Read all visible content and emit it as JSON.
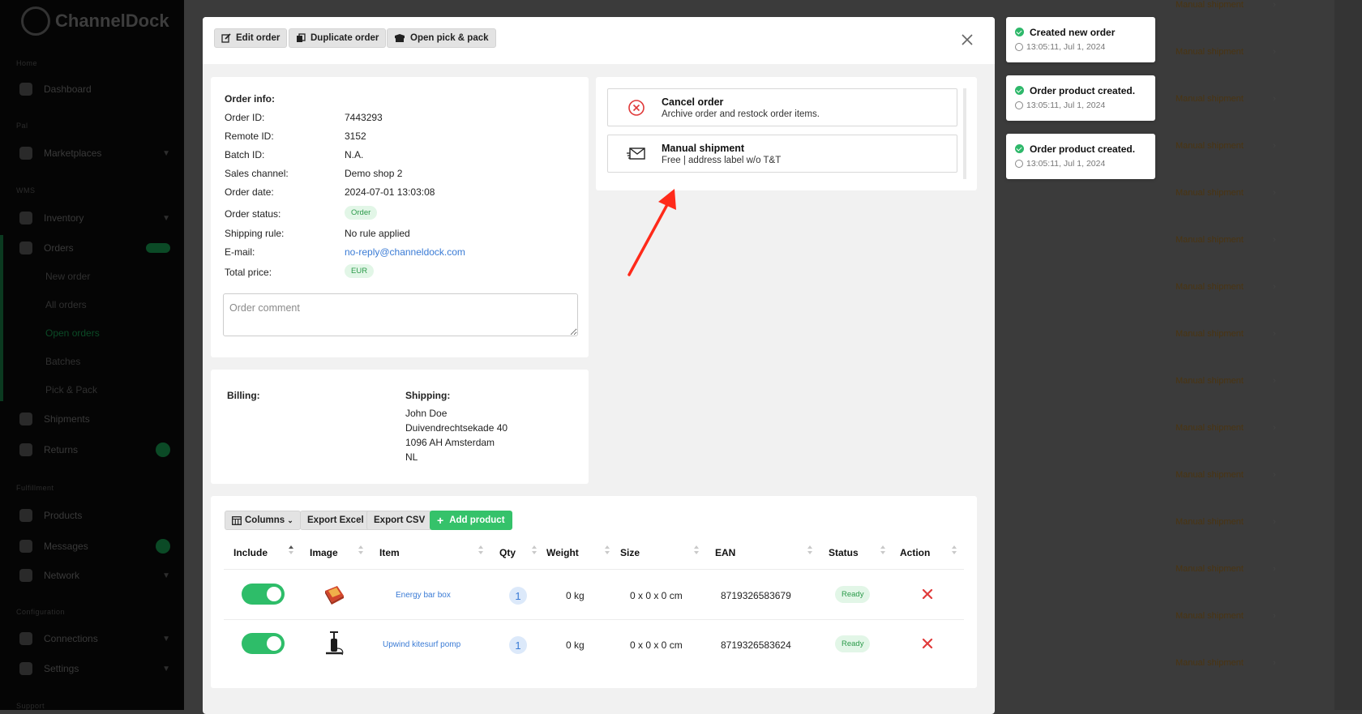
{
  "app": {
    "brand": "ChannelDock"
  },
  "sidebar": {
    "sections": [
      "Home",
      "Pal",
      "WMS",
      "Fulfillment",
      "Configuration",
      "Support"
    ],
    "items": [
      {
        "label": "Dashboard"
      },
      {
        "label": "Marketplaces"
      },
      {
        "label": "Inventory"
      },
      {
        "label": "Orders"
      },
      {
        "label": "Shipments"
      },
      {
        "label": "Returns"
      },
      {
        "label": "Products"
      },
      {
        "label": "Messages"
      },
      {
        "label": "Network"
      },
      {
        "label": "Connections"
      },
      {
        "label": "Settings"
      }
    ],
    "order_subitems": [
      "New order",
      "All orders",
      "Open orders",
      "Batches",
      "Pick & Pack"
    ]
  },
  "background": {
    "row_label": "Manual shipment",
    "top_row": [
      "3157",
      "Shopify",
      "John",
      "Doe"
    ]
  },
  "toolbar": {
    "edit_label": "Edit order",
    "duplicate_label": "Duplicate order",
    "pickpack_label": "Open pick & pack"
  },
  "order_info": {
    "title": "Order info:",
    "rows": [
      {
        "label": "Order ID:",
        "value": "7443293"
      },
      {
        "label": "Remote ID:",
        "value": "3152"
      },
      {
        "label": "Batch ID:",
        "value": "N.A."
      },
      {
        "label": "Sales channel:",
        "value": "Demo shop 2"
      },
      {
        "label": "Order date:",
        "value": "2024-07-01 13:03:08"
      },
      {
        "label": "Order status:",
        "value": "Order"
      },
      {
        "label": "Shipping rule:",
        "value": "No rule applied"
      },
      {
        "label": "E-mail:",
        "value": "no-reply@channeldock.com"
      },
      {
        "label": "Total price:",
        "value": "EUR"
      }
    ],
    "comment_placeholder": "Order comment"
  },
  "actions": [
    {
      "title": "Cancel order",
      "subtitle": "Archive order and restock order items.",
      "icon": "cancel-circle-icon"
    },
    {
      "title": "Manual shipment",
      "subtitle": "Free | address label w/o T&T",
      "icon": "envelope-icon"
    }
  ],
  "addresses": {
    "billing_label": "Billing:",
    "shipping_label": "Shipping:",
    "shipping_lines": [
      "John Doe",
      "Duivendrechtsekade 40",
      "1096 AH Amsterdam",
      "NL"
    ]
  },
  "products": {
    "buttons": {
      "columns": "Columns",
      "export_excel": "Export Excel",
      "export_csv": "Export CSV",
      "add_product": "Add product"
    },
    "headers": [
      "Include",
      "Image",
      "Item",
      "Qty",
      "Weight",
      "Size",
      "EAN",
      "Status",
      "Action"
    ],
    "rows": [
      {
        "item": "Energy bar box",
        "qty": "1",
        "weight": "0 kg",
        "size": "0 x 0 x 0 cm",
        "ean": "8719326583679",
        "status": "Ready",
        "image_icon": "energy-bar-box-image"
      },
      {
        "item": "Upwind kitesurf pomp",
        "qty": "1",
        "weight": "0 kg",
        "size": "0 x 0 x 0 cm",
        "ean": "8719326583624",
        "status": "Ready",
        "image_icon": "kitesurf-pump-image"
      }
    ]
  },
  "notifications": [
    {
      "title": "Created new order",
      "time": "13:05:11, Jul 1, 2024"
    },
    {
      "title": "Order product created.",
      "time": "13:05:11, Jul 1, 2024"
    },
    {
      "title": "Order product created.",
      "time": "13:05:11, Jul 1, 2024"
    }
  ],
  "colors": {
    "accent_green": "#35c26a",
    "link_blue": "#3a7bd5",
    "danger_red": "#e03a3a",
    "arrow_red": "#ff2a1a"
  }
}
